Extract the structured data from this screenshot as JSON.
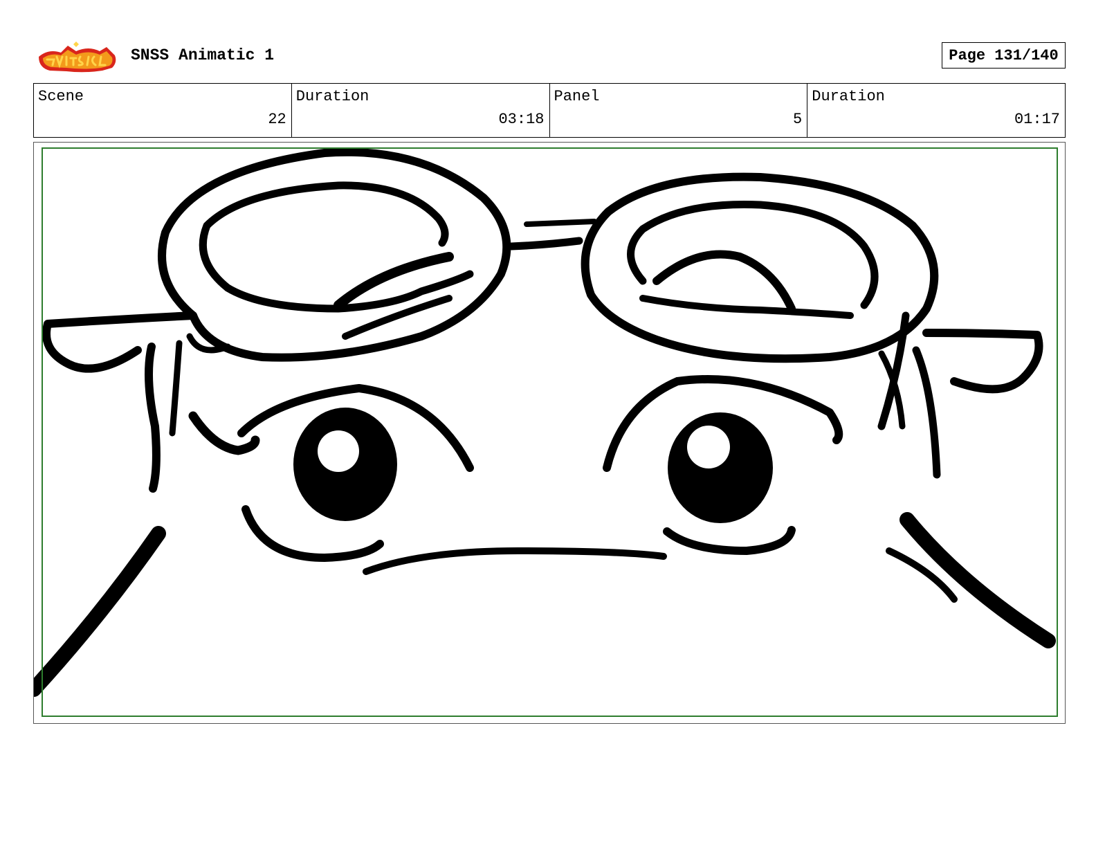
{
  "header": {
    "logo_icon": "show-logo-icon",
    "title": "SNSS Animatic 1",
    "page": "Page 131/140"
  },
  "info": {
    "scene_label": "Scene",
    "scene_value": "22",
    "scene_duration_label": "Duration",
    "scene_duration_value": "03:18",
    "panel_label": "Panel",
    "panel_value": "5",
    "panel_duration_label": "Duration",
    "panel_duration_value": "01:17"
  },
  "panel": {
    "illustration_icon": "character-face-sketch-icon",
    "safe_frame_color": "#2d7d2d"
  },
  "colors": {
    "ink": "#000000",
    "logo_red": "#d9261c",
    "logo_orange": "#f39a1b",
    "logo_yellow": "#ffd54a"
  }
}
